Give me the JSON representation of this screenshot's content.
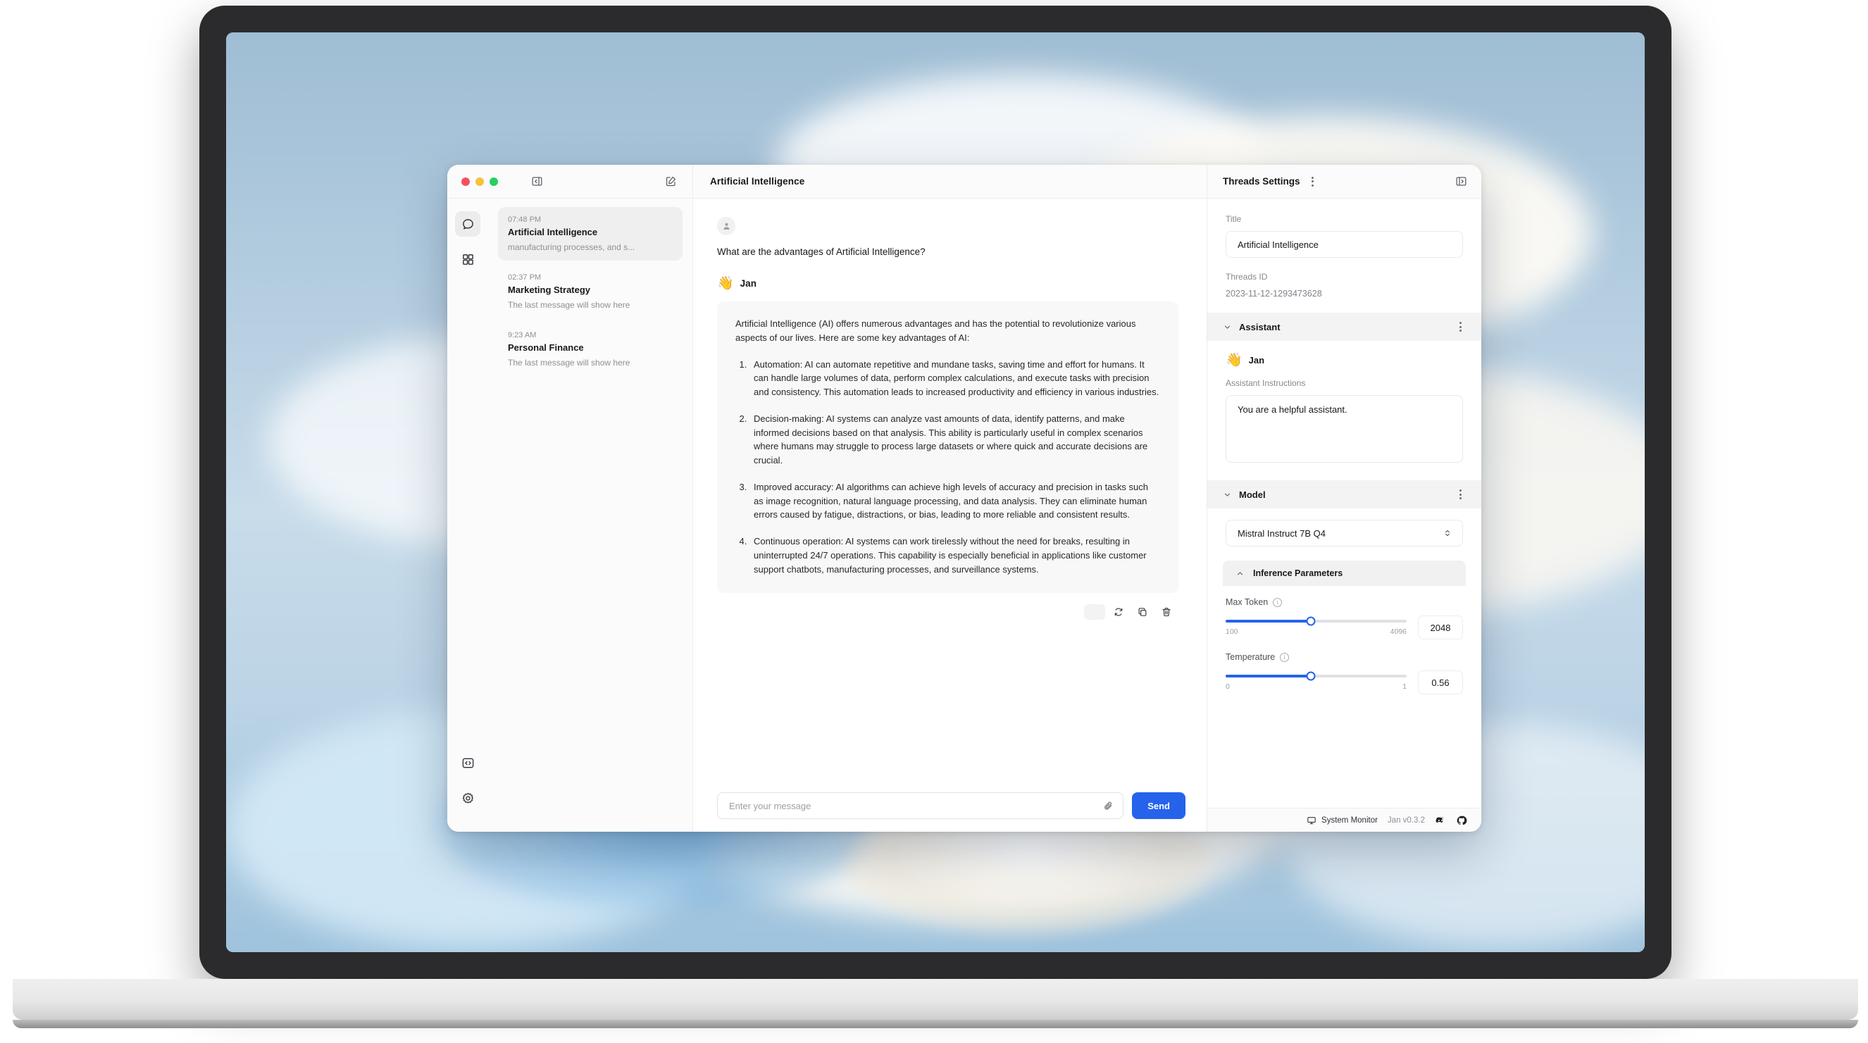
{
  "window": {
    "traffic_lights": [
      "close",
      "minimize",
      "maximize"
    ],
    "collapse_icon": "panel-collapse-icon",
    "compose_icon": "compose-icon",
    "chat_title": "Artificial Intelligence"
  },
  "rail": {
    "items": [
      {
        "icon": "chat-bubble-icon",
        "name": "chat",
        "active": true
      },
      {
        "icon": "grid-hub-icon",
        "name": "hub",
        "active": false
      }
    ],
    "bottom": [
      {
        "icon": "code-icon",
        "name": "developer"
      },
      {
        "icon": "gear-icon",
        "name": "settings"
      }
    ]
  },
  "threads": [
    {
      "time": "07:48 PM",
      "title": "Artificial Intelligence",
      "snippet": "manufacturing processes, and s...",
      "active": true
    },
    {
      "time": "02:37 PM",
      "title": "Marketing Strategy",
      "snippet": "The last message will show here",
      "active": false
    },
    {
      "time": "9:23 AM",
      "title": "Personal Finance",
      "snippet": "The last message will show here",
      "active": false
    }
  ],
  "conversation": {
    "user_message": "What are the advantages of Artificial Intelligence?",
    "bot_emoji": "👋",
    "bot_name": "Jan",
    "bot_intro": "Artificial Intelligence (AI) offers numerous advantages and has the potential to revolutionize various aspects of our lives. Here are some key advantages of AI:",
    "bot_points": [
      "Automation: AI can automate repetitive and mundane tasks, saving time and effort for humans. It can handle large volumes of data, perform complex calculations, and execute tasks with precision and consistency. This automation leads to increased productivity and efficiency in various industries.",
      "Decision-making: AI systems can analyze vast amounts of data, identify patterns, and make informed decisions based on that analysis. This ability is particularly useful in complex scenarios where humans may struggle to process large datasets or where quick and accurate decisions are crucial.",
      "Improved accuracy: AI algorithms can achieve high levels of accuracy and precision in tasks such as image recognition, natural language processing, and data analysis. They can eliminate human errors caused by fatigue, distractions, or bias, leading to more reliable and consistent results.",
      "Continuous operation: AI systems can work tirelessly without the need for breaks, resulting in uninterrupted 24/7 operations. This capability is especially beneficial in applications like customer support chatbots, manufacturing processes, and surveillance systems."
    ],
    "actions": [
      {
        "icon": "regenerate-icon",
        "label": "Regenerate"
      },
      {
        "icon": "copy-icon",
        "label": "Copy"
      },
      {
        "icon": "trash-icon",
        "label": "Delete"
      }
    ]
  },
  "composer": {
    "placeholder": "Enter your message",
    "value": "",
    "attach_icon": "paperclip-icon",
    "send_label": "Send"
  },
  "settings": {
    "header_title": "Threads Settings",
    "expand_icon": "panel-expand-icon",
    "title_label": "Title",
    "title_value": "Artificial Intelligence",
    "threads_id_label": "Threads ID",
    "threads_id_value": "2023-11-12-1293473628",
    "assistant_section": "Assistant",
    "assistant_emoji": "👋",
    "assistant_name": "Jan",
    "instructions_label": "Assistant Instructions",
    "instructions_value": "You are a helpful assistant.",
    "model_section": "Model",
    "model_value": "Mistral Instruct 7B Q4",
    "inference_section": "Inference Parameters",
    "parameters": [
      {
        "name": "Max Token",
        "min": "100",
        "max": "4096",
        "value": "2048",
        "percent": 47
      },
      {
        "name": "Temperature",
        "min": "0",
        "max": "1",
        "value": "0.56",
        "percent": 47
      }
    ]
  },
  "statusbar": {
    "system_monitor": "System Monitor",
    "monitor_icon": "monitor-icon",
    "version": "Jan v0.3.2",
    "discord_icon": "discord-icon",
    "github_icon": "github-icon"
  },
  "colors": {
    "accent": "#2563eb",
    "active_thread_bg": "#efefef",
    "bubble_bg": "#f8f8f8"
  }
}
